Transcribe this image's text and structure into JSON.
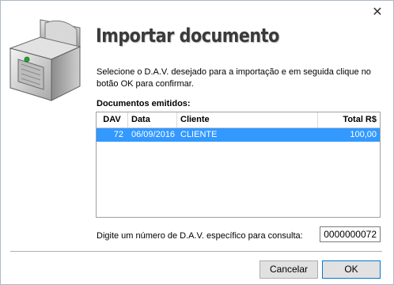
{
  "window": {
    "title": "Importar documento",
    "close_icon": "close-icon",
    "close_glyph": "✕"
  },
  "instructions": "Selecione o D.A.V. desejado para a importação e em seguida clique no botão OK para confirmar.",
  "documents": {
    "label": "Documentos emitidos:",
    "columns": [
      "DAV",
      "Data",
      "Cliente",
      "Total R$"
    ],
    "rows": [
      {
        "dav": "72",
        "data": "06/09/2016",
        "cliente": "CLIENTE",
        "total": "100,00"
      }
    ],
    "selected_row_color": "#3399ff"
  },
  "search": {
    "label": "Digite um número de D.A.V. específico para consulta:",
    "value": "0000000072"
  },
  "buttons": {
    "cancel": "Cancelar",
    "ok": "OK"
  },
  "icon": "printer-icon"
}
